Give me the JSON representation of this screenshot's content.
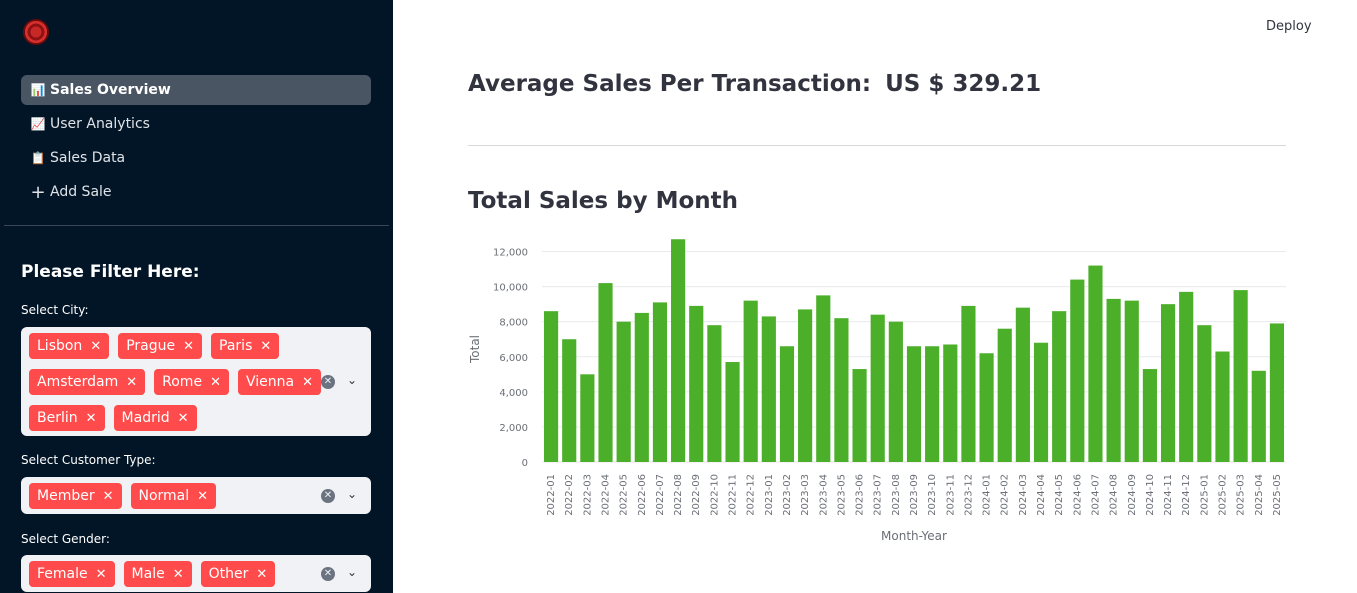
{
  "header": {
    "deploy_label": "Deploy"
  },
  "sidebar": {
    "logo_icon": "app-logo",
    "nav": [
      {
        "label": "Sales Overview",
        "icon": "bar-chart-icon",
        "glyph": "📊",
        "active": true
      },
      {
        "label": "User Analytics",
        "icon": "trend-chart-icon",
        "glyph": "📈",
        "active": false
      },
      {
        "label": "Sales Data",
        "icon": "clipboard-icon",
        "glyph": "📋",
        "active": false
      },
      {
        "label": "Add Sale",
        "icon": "plus-icon",
        "glyph": "+",
        "active": false
      }
    ],
    "filter_title": "Please Filter Here:",
    "filters": [
      {
        "label": "Select City:",
        "values": [
          "Lisbon",
          "Prague",
          "Paris",
          "Amsterdam",
          "Rome",
          "Vienna",
          "Berlin",
          "Madrid"
        ]
      },
      {
        "label": "Select Customer Type:",
        "values": [
          "Member",
          "Normal"
        ]
      },
      {
        "label": "Select Gender:",
        "values": [
          "Female",
          "Male",
          "Other"
        ]
      }
    ]
  },
  "main": {
    "avg_label": "Average Sales Per Transaction:",
    "avg_value": "US $ 329.21",
    "chart_title": "Total Sales by Month"
  },
  "chart_data": {
    "type": "bar",
    "title": "Total Sales by Month",
    "xlabel": "Month-Year",
    "ylabel": "Total",
    "ylim": [
      0,
      12000
    ],
    "yticks": [
      0,
      2000,
      4000,
      6000,
      8000,
      10000,
      12000
    ],
    "ytick_labels": [
      "0",
      "2,000",
      "4,000",
      "6,000",
      "8,000",
      "10,000",
      "12,000"
    ],
    "color": "#4caf2a",
    "grid": true,
    "categories": [
      "2022-01",
      "2022-02",
      "2022-03",
      "2022-04",
      "2022-05",
      "2022-06",
      "2022-07",
      "2022-08",
      "2022-09",
      "2022-10",
      "2022-11",
      "2022-12",
      "2023-01",
      "2023-02",
      "2023-03",
      "2023-04",
      "2023-05",
      "2023-06",
      "2023-07",
      "2023-08",
      "2023-09",
      "2023-10",
      "2023-11",
      "2023-12",
      "2024-01",
      "2024-02",
      "2024-03",
      "2024-04",
      "2024-05",
      "2024-06",
      "2024-07",
      "2024-08",
      "2024-09",
      "2024-10",
      "2024-11",
      "2024-12",
      "2025-01",
      "2025-02",
      "2025-03",
      "2025-04",
      "2025-05"
    ],
    "values": [
      8600,
      7000,
      5000,
      10200,
      8000,
      8500,
      9100,
      12700,
      8900,
      7800,
      5700,
      9200,
      8300,
      6600,
      8700,
      9500,
      8200,
      5300,
      8400,
      8000,
      6600,
      6600,
      6700,
      8900,
      6200,
      7600,
      8800,
      6800,
      8600,
      10400,
      11200,
      9300,
      9200,
      5300,
      9000,
      9700,
      7800,
      6300,
      9800,
      5200,
      7900
    ]
  }
}
